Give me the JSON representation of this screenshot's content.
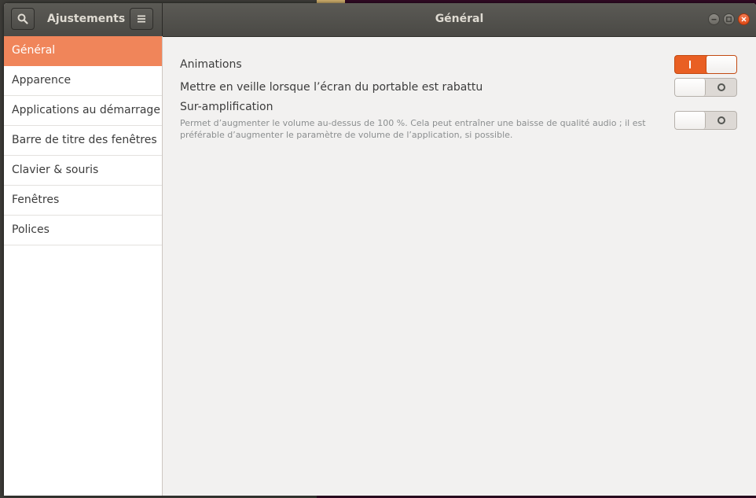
{
  "app": {
    "title": "Ajustements",
    "page_title": "Général"
  },
  "icons": {
    "search": "search-icon",
    "menu": "hamburger-menu-icon",
    "minimize": "minimize-icon",
    "maximize": "maximize-icon",
    "close": "close-icon"
  },
  "sidebar": {
    "items": [
      {
        "label": "Général",
        "active": true
      },
      {
        "label": "Apparence",
        "active": false
      },
      {
        "label": "Applications au démarrage",
        "active": false
      },
      {
        "label": "Barre de titre des fenêtres",
        "active": false
      },
      {
        "label": "Clavier & souris",
        "active": false
      },
      {
        "label": "Fenêtres",
        "active": false
      },
      {
        "label": "Polices",
        "active": false
      }
    ]
  },
  "settings": [
    {
      "label": "Animations",
      "enabled": true
    },
    {
      "label": "Mettre en veille lorsque l’écran du portable est rabattu",
      "enabled": false
    },
    {
      "label": "Sur-amplification",
      "description": "Permet d’augmenter le volume au-dessus de 100 %. Cela peut entraîner une baisse de qualité audio ; il est préférable d’augmenter le paramètre de volume de l’application, si possible.",
      "enabled": false
    }
  ],
  "colors": {
    "accent": "#f0855a",
    "switch_on": "#e95f23",
    "titlebar": "#4f4e4a",
    "close_button": "#e95420"
  }
}
